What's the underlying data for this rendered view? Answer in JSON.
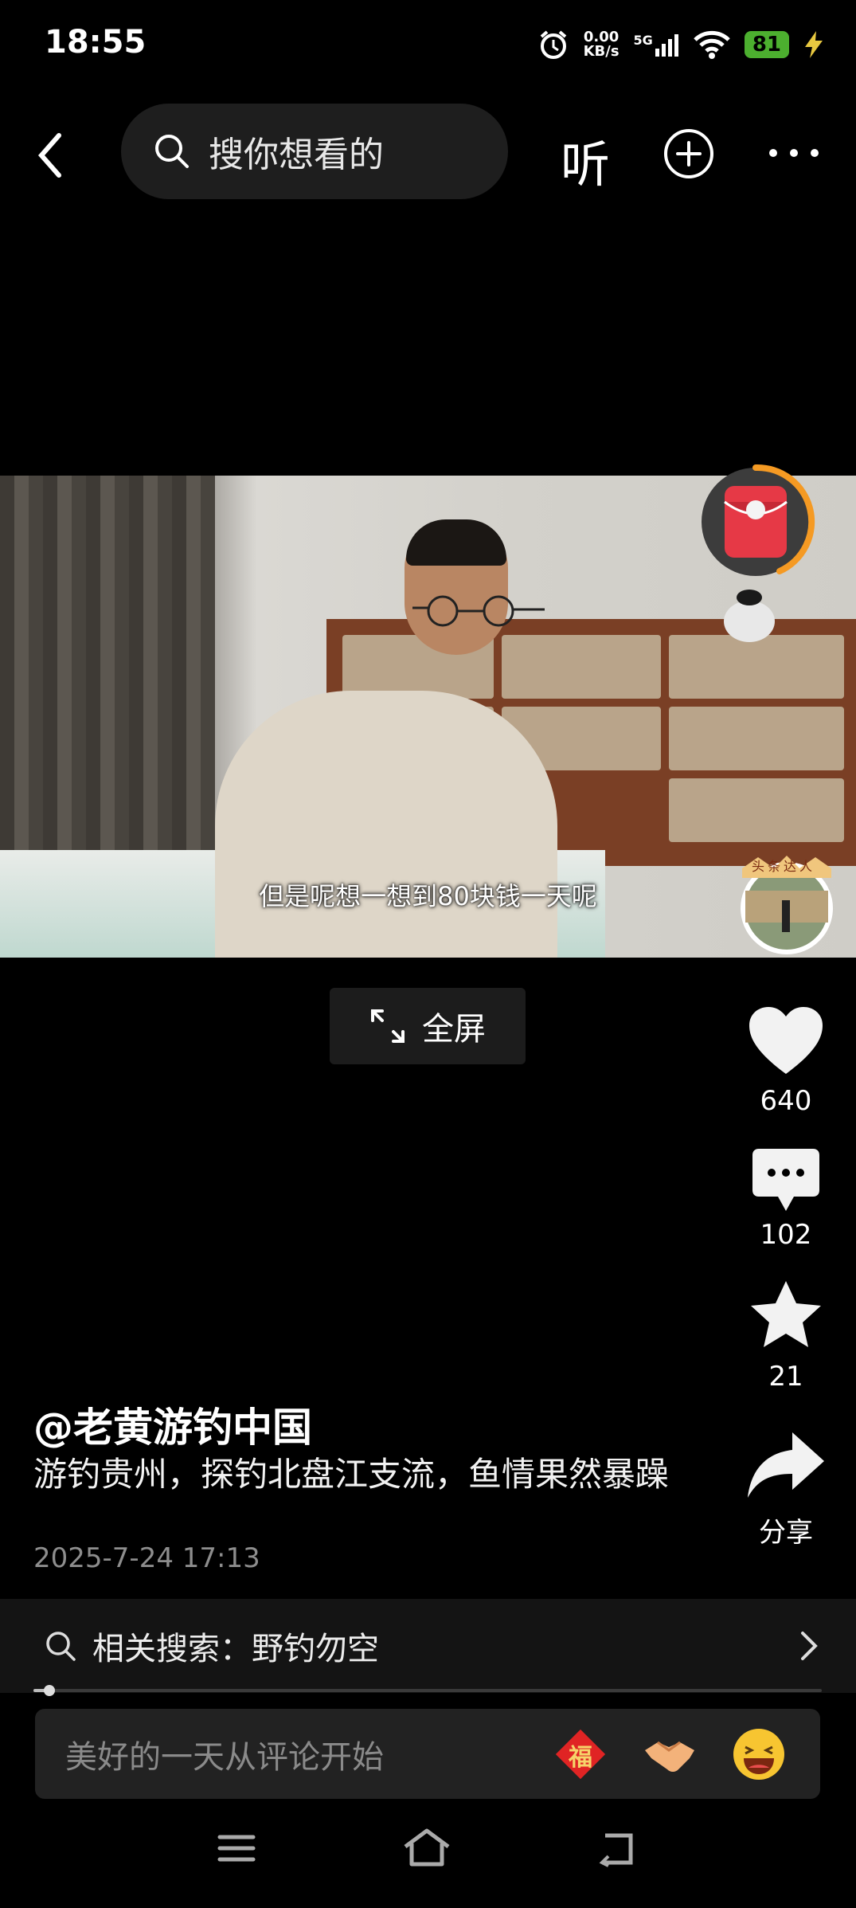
{
  "status_bar": {
    "time": "18:55",
    "net_speed_value": "0.00",
    "net_speed_unit": "KB/s",
    "network": "5G",
    "battery": "81"
  },
  "top_bar": {
    "search_placeholder": "搜你想看的",
    "listen_label": "听"
  },
  "video": {
    "subtitle": "但是呢想一想到80块钱一天呢",
    "badge_text": "头条达人",
    "fullscreen_label": "全屏"
  },
  "actions": {
    "like_count": "640",
    "comment_count": "102",
    "favorite_count": "21",
    "share_label": "分享"
  },
  "post": {
    "author": "@老黄游钓中国",
    "description": "游钓贵州，探钓北盘江支流，鱼情果然暴躁",
    "date": "2025-7-24 17:13"
  },
  "related_search": {
    "label": "相关搜索：野钓勿空"
  },
  "playback": {
    "progress_fraction": 0.02
  },
  "comment_bar": {
    "placeholder": "美好的一天从评论开始",
    "fu_char": "福"
  },
  "colors": {
    "accent_orange": "#f59a23",
    "battery_green": "#4caf2f",
    "red_packet": "#e63946"
  }
}
